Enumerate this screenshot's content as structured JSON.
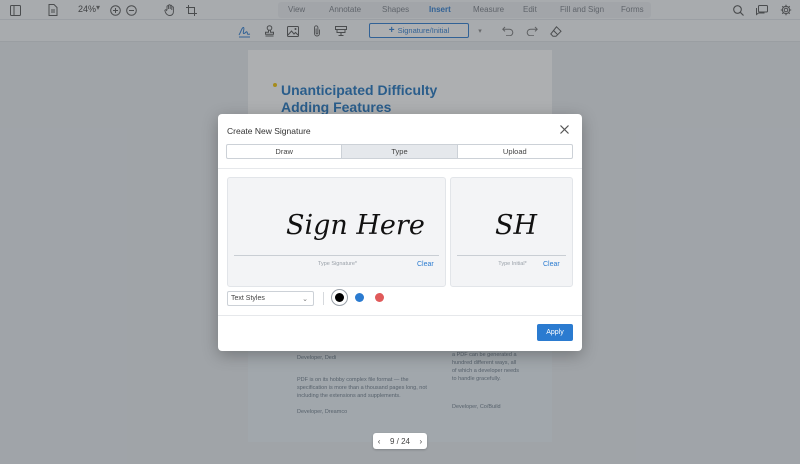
{
  "toolbar": {
    "zoom_value": "24%",
    "tabs": [
      "View",
      "Annotate",
      "Shapes",
      "Insert",
      "Measure",
      "Edit",
      "Fill and Sign",
      "Forms"
    ],
    "active_tab": "Insert"
  },
  "subtoolbar": {
    "signature_button_label": "Signature/Initial"
  },
  "document": {
    "title": "Unanticipated Difficulty Adding Features",
    "lower_left_1": "Developer, Dedi",
    "lower_left_2": "PDF is on its hobby complex file format — the specification is more than a thousand pages long, not including the extensions and supplements.",
    "lower_left_3": "Developer, Dreamco",
    "lower_right_1": "a PDF can be generated a hundred different ways, all of which a developer needs to handle gracefully.",
    "lower_right_2": "Developer, Co/Build"
  },
  "pager": {
    "current": "9",
    "total": "24",
    "text": "9 / 24"
  },
  "dialog": {
    "title": "Create New Signature",
    "tabs": [
      "Draw",
      "Type",
      "Upload"
    ],
    "active_tab": "Type",
    "signature_text": "Sign Here",
    "signature_hint": "Type Signature*",
    "initial_text": "SH",
    "initial_hint": "Type Initial*",
    "clear_label": "Clear",
    "text_styles_label": "Text Styles",
    "colors": [
      "#000000",
      "#2b7bd0",
      "#e05a5a"
    ],
    "selected_color": "#000000",
    "apply_label": "Apply"
  }
}
